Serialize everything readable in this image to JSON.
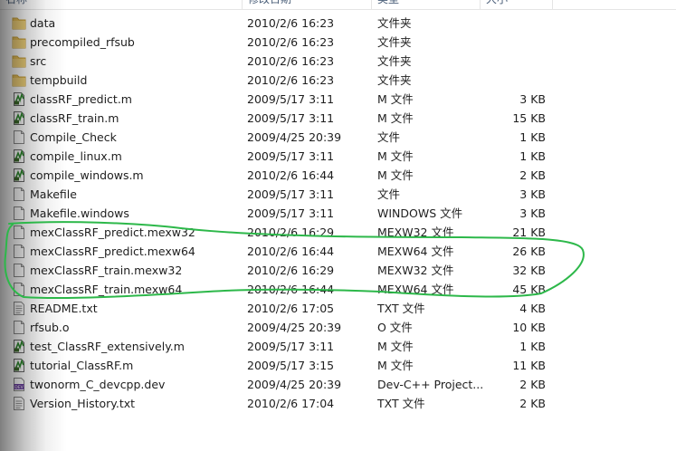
{
  "header": {
    "name": "名称",
    "date": "修改日期",
    "type": "类型",
    "size": "大小"
  },
  "files": [
    {
      "name": "data",
      "date": "2010/2/6 16:23",
      "type": "文件夹",
      "size": "",
      "icon": "folder-icon"
    },
    {
      "name": "precompiled_rfsub",
      "date": "2010/2/6 16:23",
      "type": "文件夹",
      "size": "",
      "icon": "folder-icon"
    },
    {
      "name": "src",
      "date": "2010/2/6 16:23",
      "type": "文件夹",
      "size": "",
      "icon": "folder-icon"
    },
    {
      "name": "tempbuild",
      "date": "2010/2/6 16:23",
      "type": "文件夹",
      "size": "",
      "icon": "folder-icon"
    },
    {
      "name": "classRF_predict.m",
      "date": "2009/5/17 3:11",
      "type": "M 文件",
      "size": "3 KB",
      "icon": "m-file-icon"
    },
    {
      "name": "classRF_train.m",
      "date": "2009/5/17 3:11",
      "type": "M 文件",
      "size": "15 KB",
      "icon": "m-file-icon"
    },
    {
      "name": "Compile_Check",
      "date": "2009/4/25 20:39",
      "type": "文件",
      "size": "1 KB",
      "icon": "blank-file-icon"
    },
    {
      "name": "compile_linux.m",
      "date": "2009/5/17 3:11",
      "type": "M 文件",
      "size": "1 KB",
      "icon": "m-file-icon"
    },
    {
      "name": "compile_windows.m",
      "date": "2010/2/6 16:44",
      "type": "M 文件",
      "size": "2 KB",
      "icon": "m-file-icon"
    },
    {
      "name": "Makefile",
      "date": "2009/5/17 3:11",
      "type": "文件",
      "size": "3 KB",
      "icon": "blank-file-icon"
    },
    {
      "name": "Makefile.windows",
      "date": "2009/5/17 3:11",
      "type": "WINDOWS 文件",
      "size": "3 KB",
      "icon": "blank-file-icon"
    },
    {
      "name": "mexClassRF_predict.mexw32",
      "date": "2010/2/6 16:29",
      "type": "MEXW32 文件",
      "size": "21 KB",
      "icon": "blank-file-icon"
    },
    {
      "name": "mexClassRF_predict.mexw64",
      "date": "2010/2/6 16:44",
      "type": "MEXW64 文件",
      "size": "26 KB",
      "icon": "blank-file-icon"
    },
    {
      "name": "mexClassRF_train.mexw32",
      "date": "2010/2/6 16:29",
      "type": "MEXW32 文件",
      "size": "32 KB",
      "icon": "blank-file-icon"
    },
    {
      "name": "mexClassRF_train.mexw64",
      "date": "2010/2/6 16:44",
      "type": "MEXW64 文件",
      "size": "45 KB",
      "icon": "blank-file-icon"
    },
    {
      "name": "README.txt",
      "date": "2010/2/6 17:05",
      "type": "TXT 文件",
      "size": "4 KB",
      "icon": "text-file-icon"
    },
    {
      "name": "rfsub.o",
      "date": "2009/4/25 20:39",
      "type": "O 文件",
      "size": "10 KB",
      "icon": "blank-file-icon"
    },
    {
      "name": "test_ClassRF_extensively.m",
      "date": "2009/5/17 3:11",
      "type": "M 文件",
      "size": "1 KB",
      "icon": "m-file-icon"
    },
    {
      "name": "tutorial_ClassRF.m",
      "date": "2009/5/17 3:15",
      "type": "M 文件",
      "size": "11 KB",
      "icon": "m-file-icon"
    },
    {
      "name": "twonorm_C_devcpp.dev",
      "date": "2009/4/25 20:39",
      "type": "Dev-C++ Project...",
      "size": "2 KB",
      "icon": "devcpp-project-icon"
    },
    {
      "name": "Version_History.txt",
      "date": "2010/2/6 17:04",
      "type": "TXT 文件",
      "size": "2 KB",
      "icon": "text-file-icon"
    }
  ],
  "colors": {
    "annotation": "#2db84a",
    "folder": "#e8c15a",
    "header_text": "#4c607a"
  }
}
